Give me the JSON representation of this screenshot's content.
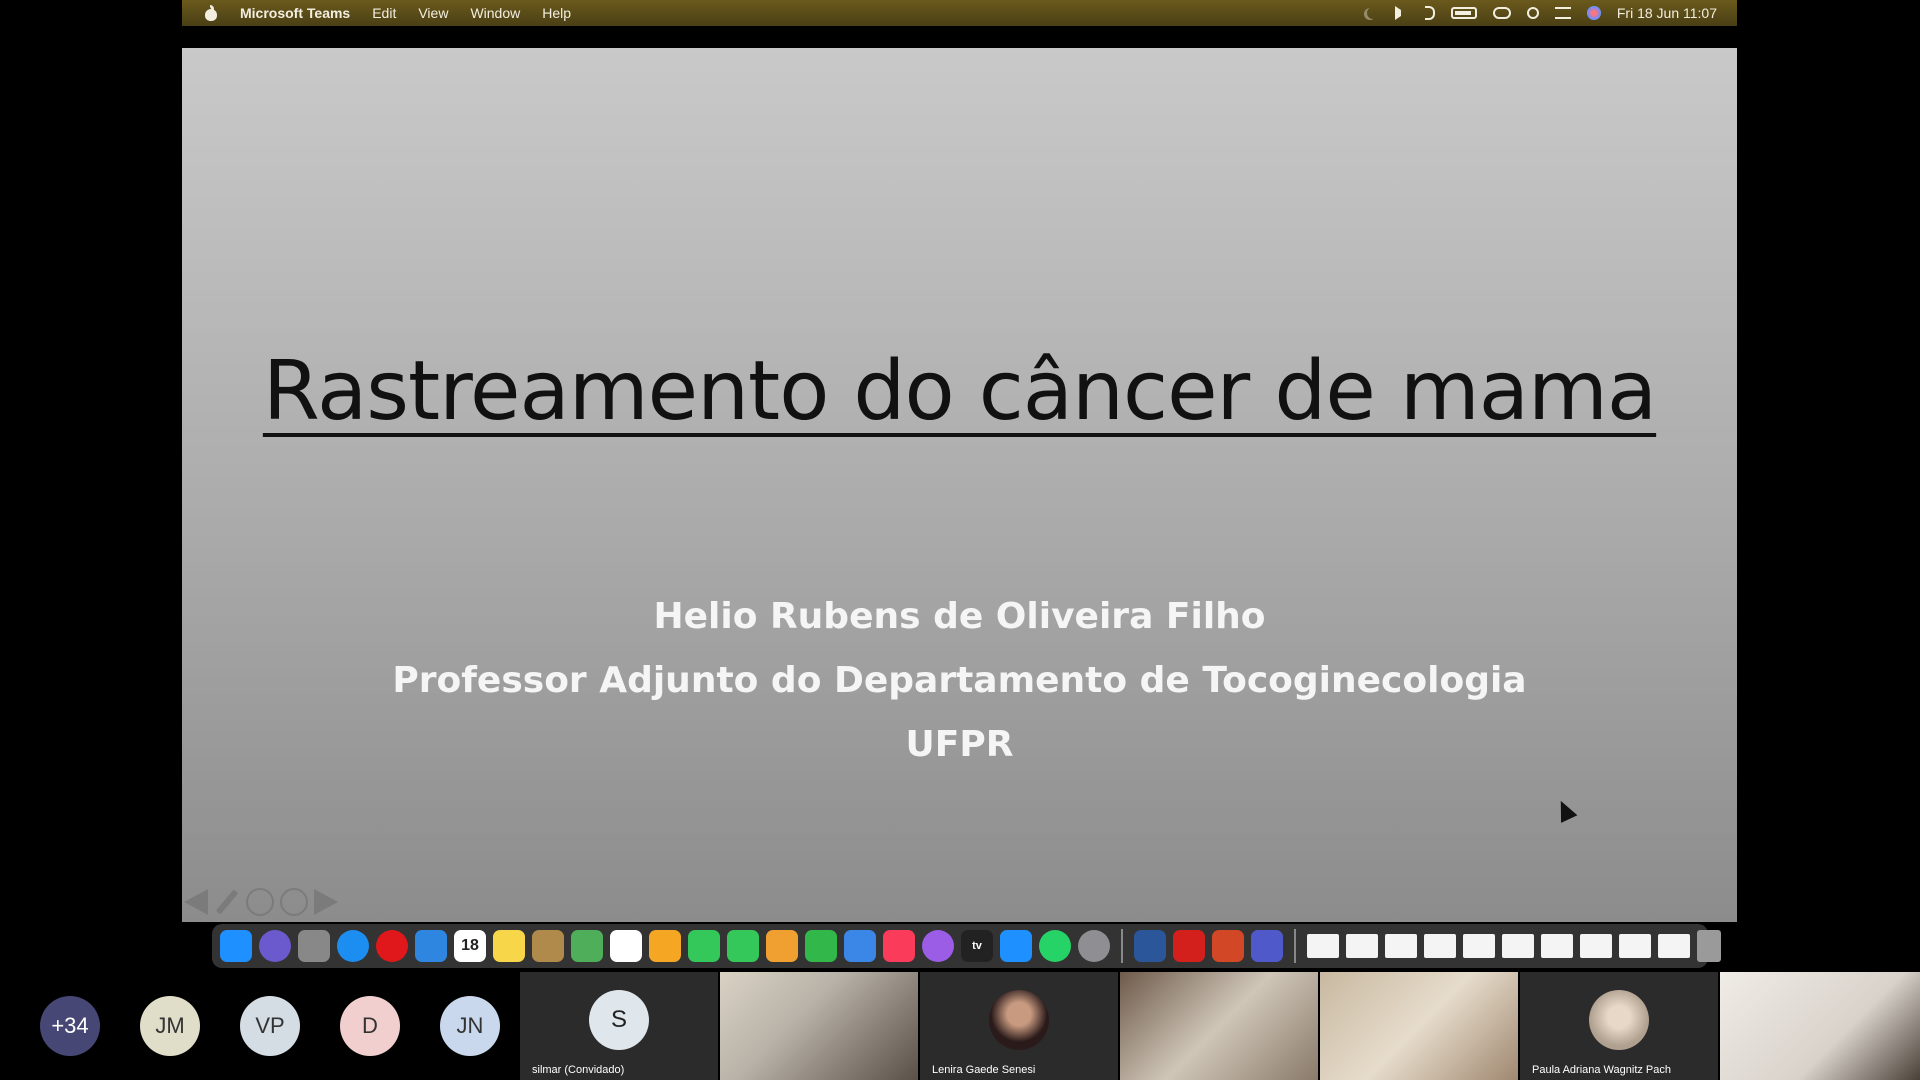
{
  "menubar": {
    "app": "Microsoft Teams",
    "items": [
      "Edit",
      "View",
      "Window",
      "Help"
    ],
    "clock": "Fri 18 Jun  11:07"
  },
  "slide": {
    "title": "Rastreamento do câncer de mama",
    "lines": [
      "Helio Rubens de Oliveira Filho",
      "Professor Adjunto do Departamento de Tocoginecologia",
      "UFPR"
    ]
  },
  "dock": {
    "calendar_day": "18",
    "tv_label": "tv",
    "app_icons": [
      "finder-icon",
      "siri-icon",
      "launchpad-icon",
      "safari-icon",
      "opera-icon",
      "mail-icon",
      "calendar-icon",
      "notes-icon",
      "contacts-icon",
      "maps-icon",
      "reminders-icon",
      "photos-icon",
      "messages-icon",
      "facetime-icon",
      "pages-icon",
      "numbers-icon",
      "keynote-icon",
      "music-icon",
      "podcasts-icon",
      "appletv-icon",
      "appstore-icon",
      "whatsapp-icon",
      "settings-icon",
      "word-icon",
      "acrobat-icon",
      "powerpoint-icon",
      "teams-icon"
    ],
    "colors": [
      "#1e90ff",
      "#6a5acd",
      "#888888",
      "#1c8ef2",
      "#e0181b",
      "#2f86e0",
      "#ffffff",
      "#f7d64a",
      "#b08a4a",
      "#4fae5a",
      "#ffffff",
      "#f5a623",
      "#34c759",
      "#34c759",
      "#f0a030",
      "#32b84a",
      "#3a87e8",
      "#fa3c5a",
      "#9b5de5",
      "#222222",
      "#1e90ff",
      "#25d366",
      "#8e8e93",
      "#2b579a",
      "#d4201c",
      "#d24726",
      "#5059c9"
    ]
  },
  "participants": {
    "avatars": [
      {
        "initials": "+34",
        "color": "#464775",
        "text_color": "#ffffff"
      },
      {
        "initials": "JM",
        "color": "#e0ddc8",
        "text_color": "#333333"
      },
      {
        "initials": "VP",
        "color": "#d5dde4",
        "text_color": "#333333"
      },
      {
        "initials": "D",
        "color": "#f1cfcf",
        "text_color": "#333333"
      },
      {
        "initials": "JN",
        "color": "#c9d8ec",
        "text_color": "#333333"
      }
    ],
    "tiles": [
      {
        "name": "silmar (Convidado)",
        "initial": "S"
      },
      {
        "name": ""
      },
      {
        "name": "Lenira Gaede Senesi"
      },
      {
        "name": ""
      },
      {
        "name": ""
      },
      {
        "name": "Paula Adriana Wagnitz Pach"
      },
      {
        "name": ""
      }
    ]
  }
}
